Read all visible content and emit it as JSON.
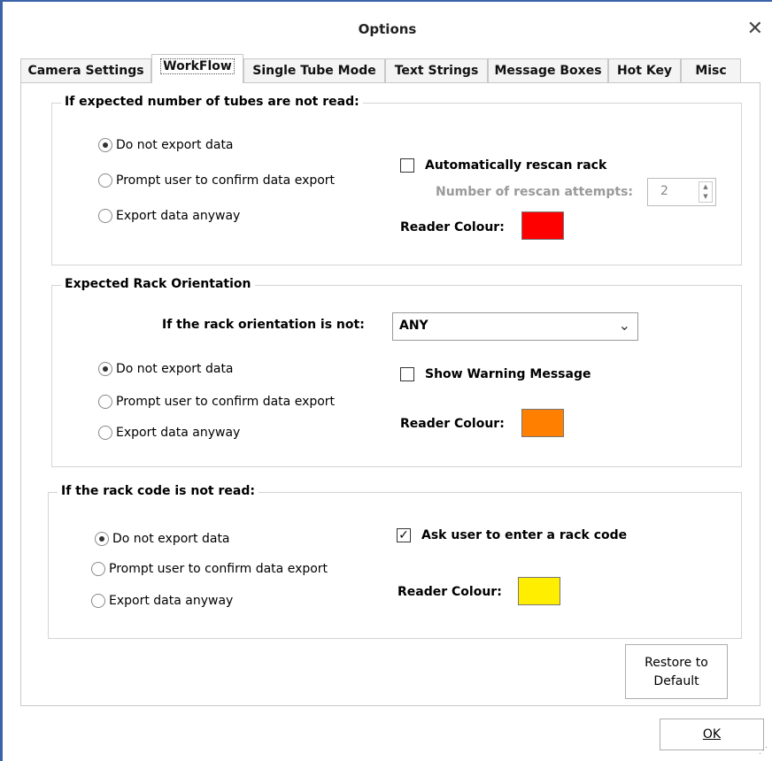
{
  "window": {
    "title": "Options",
    "close_glyph": "✕"
  },
  "tabs": [
    {
      "label": "Camera Settings"
    },
    {
      "label": "WorkFlow",
      "active": true
    },
    {
      "label": "Single Tube Mode"
    },
    {
      "label": "Text Strings"
    },
    {
      "label": "Message Boxes"
    },
    {
      "label": "Hot Key"
    },
    {
      "label": "Misc"
    }
  ],
  "group1": {
    "title": "If expected number of tubes are not read:",
    "radios": [
      "Do not export data",
      "Prompt user to confirm data export",
      "Export data anyway"
    ],
    "selected": 0,
    "auto_rescan": {
      "label": "Automatically rescan rack",
      "checked": false
    },
    "rescan_attempts": {
      "label": "Number of rescan attempts:",
      "value": "2"
    },
    "reader_colour": {
      "label": "Reader Colour:",
      "color": "#ff0000"
    }
  },
  "group2": {
    "title": "Expected Rack Orientation",
    "orientation_label": "If the rack orientation is not:",
    "orientation_value": "ANY",
    "radios": [
      "Do not export data",
      "Prompt user to confirm data export",
      "Export data anyway"
    ],
    "selected": 0,
    "show_warning": {
      "label": "Show Warning Message",
      "checked": false
    },
    "reader_colour": {
      "label": "Reader Colour:",
      "color": "#ff7f00"
    }
  },
  "group3": {
    "title": "If the rack code is not read:",
    "radios": [
      "Do not export data",
      "Prompt user to confirm data export",
      "Export data anyway"
    ],
    "selected": 0,
    "ask_rack_code": {
      "label": "Ask user to enter a rack code",
      "checked": true,
      "check_glyph": "✓"
    },
    "reader_colour": {
      "label": "Reader Colour:",
      "color": "#ffee00"
    }
  },
  "buttons": {
    "restore_line1": "Restore to",
    "restore_line2": "Default",
    "ok_label": "OK"
  }
}
